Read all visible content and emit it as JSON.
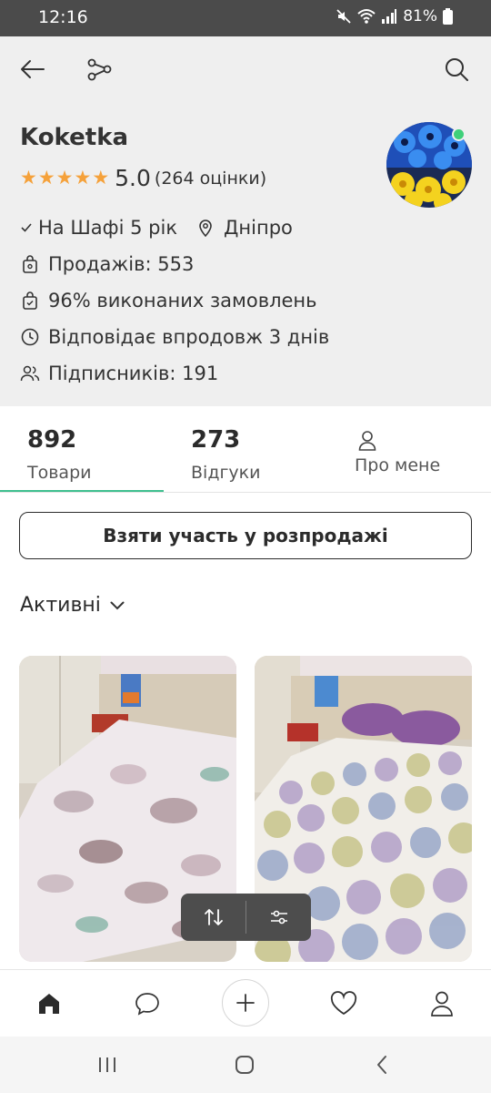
{
  "status_bar": {
    "time": "12:16",
    "battery": "81%",
    "icons": [
      "mute-icon",
      "wifi-icon",
      "signal-icon",
      "battery-icon"
    ]
  },
  "header": {
    "back_icon": "back-arrow-icon",
    "share_icon": "share-icon",
    "search_icon": "search-icon"
  },
  "shop": {
    "name": "Koketka",
    "rating_value": "5.0",
    "rating_count": "(264 оцінки)",
    "stars": 5,
    "on_shafa": "На Шафі 5 рік",
    "city": "Дніпро",
    "sales": "Продажів: 553",
    "completed": "96% виконаних замовлень",
    "responds": "Відповідає впродовж 3 днів",
    "followers": "Підписників: 191",
    "online": true
  },
  "tabs": [
    {
      "number": "892",
      "label": "Товари",
      "active": true
    },
    {
      "number": "273",
      "label": "Відгуки",
      "active": false
    },
    {
      "label": "Про мене",
      "icon": "user-icon",
      "active": false
    }
  ],
  "sale_button": "Взяти участь у розпродажі",
  "filter": {
    "label": "Активні",
    "icon": "chevron-down-icon"
  },
  "sort_bar": {
    "sort_icon": "sort-arrows-icon",
    "filter_icon": "sliders-icon"
  },
  "bottom_nav": [
    {
      "icon": "home-icon",
      "active": true
    },
    {
      "icon": "chat-icon",
      "active": false
    },
    {
      "icon": "plus-icon",
      "active": false
    },
    {
      "icon": "heart-icon",
      "active": false
    },
    {
      "icon": "profile-icon",
      "active": false
    }
  ],
  "system_nav": [
    "recent-apps-icon",
    "home-button-icon",
    "back-icon"
  ],
  "colors": {
    "accent": "#3fbf8f",
    "star": "#f5a13a",
    "header_bg": "#efefef",
    "status_bg": "#4b4b4b"
  }
}
